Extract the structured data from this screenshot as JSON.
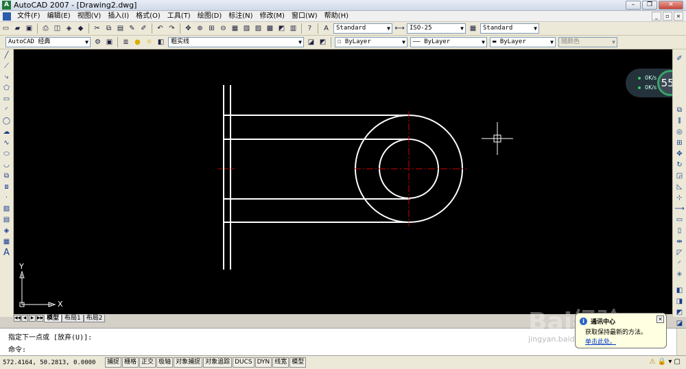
{
  "window": {
    "title": "AutoCAD 2007 - [Drawing2.dwg]",
    "buttons": [
      "–",
      "❐",
      "✕"
    ]
  },
  "menu": {
    "items": [
      "文件(F)",
      "编辑(E)",
      "视图(V)",
      "插入(I)",
      "格式(O)",
      "工具(T)",
      "绘图(D)",
      "标注(N)",
      "修改(M)",
      "窗口(W)",
      "帮助(H)"
    ]
  },
  "toolbar_styles": {
    "text_style": "Standard",
    "dim_style": "ISO-25",
    "table_style": "Standard"
  },
  "toolbar_layers": {
    "workspace": "AutoCAD 经典",
    "layer": "粗实线",
    "color": "ByLayer",
    "linetype": "ByLayer",
    "lineweight": "ByLayer",
    "plotstyle": "随颜色"
  },
  "meter": {
    "up": "0K/s",
    "down": "0K/s",
    "percent": "55",
    "percent_unit": "%"
  },
  "axis": {
    "x": "X",
    "y": "Y"
  },
  "tabs": [
    "模型",
    "布局1",
    "布局2"
  ],
  "command": {
    "history": "指定下一点或 [放弃(U)]:",
    "prompt": "命令:"
  },
  "status": {
    "coords": "572.4164, 50.2813, 0.0000",
    "toggles": [
      "捕捉",
      "栅格",
      "正交",
      "极轴",
      "对象捕捉",
      "对象追踪",
      "DUCS",
      "DYN",
      "线宽",
      "模型"
    ]
  },
  "balloon": {
    "title": "通讯中心",
    "message": "获取保持最新的方法。",
    "link": "单击此处。"
  },
  "watermark": {
    "brand": "Bai经验",
    "url": "jingyan.baidu.com"
  },
  "colors": {
    "canvas": "#000000",
    "geometry": "#ffffff",
    "centerline": "#cc0000"
  }
}
